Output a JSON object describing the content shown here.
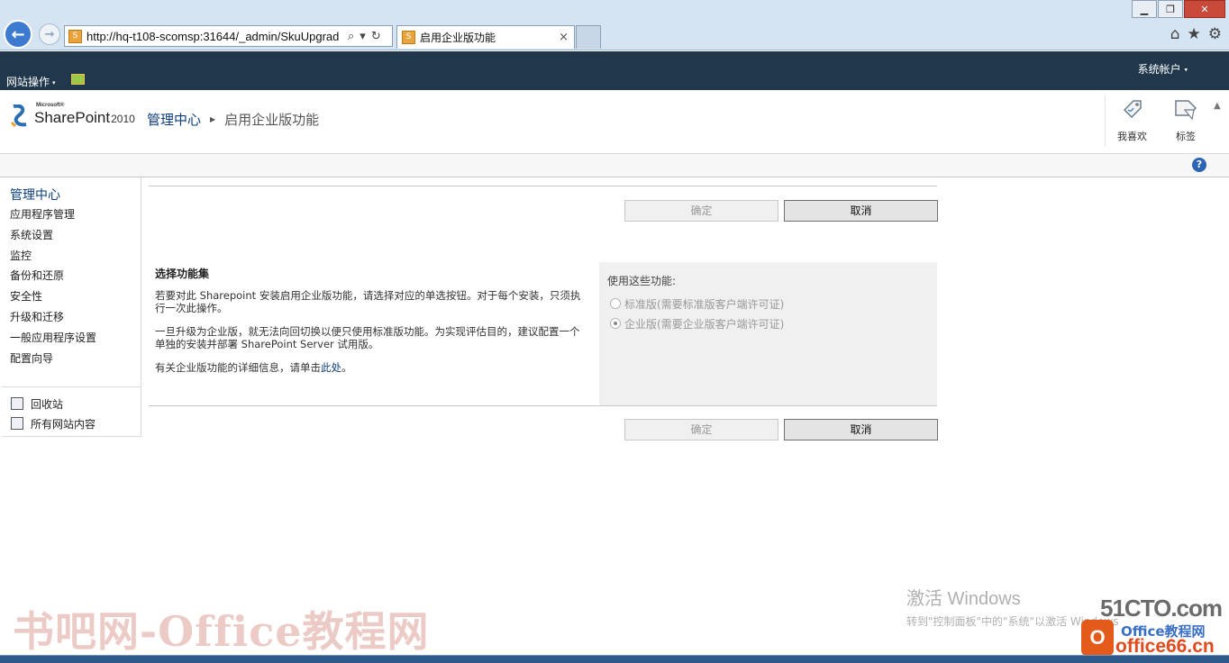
{
  "browser": {
    "address": "http://hq-t108-scomsp:31644/_admin/SkuUpgrad",
    "tab_title": "启用企业版功能",
    "tab_close": "×",
    "win_min": "▁",
    "win_restore": "❐",
    "win_close": "✕",
    "back_glyph": "←",
    "fwd_glyph": "→",
    "search_glyph": "⌕",
    "dropdown_glyph": "▾",
    "refresh_glyph": "↻",
    "home_glyph": "⌂",
    "fav_glyph": "★",
    "settings_glyph": "⚙"
  },
  "ribbon": {
    "site_actions": "网站操作",
    "caret": "▾",
    "account": "系统帐户",
    "account_caret": "▾"
  },
  "logo": {
    "microsoft": "Microsoft®",
    "product": "SharePoint",
    "year": "2010"
  },
  "breadcrumb": {
    "root": "管理中心",
    "sep": "▶",
    "current": "启用企业版功能"
  },
  "social": {
    "like": "我喜欢",
    "tags": "标签"
  },
  "help": "?",
  "left_nav": {
    "heading": "管理中心",
    "items": [
      "应用程序管理",
      "系统设置",
      "监控",
      "备份和还原",
      "安全性",
      "升级和迁移",
      "一般应用程序设置",
      "配置向导"
    ],
    "recycle_bin": "回收站",
    "all_content": "所有网站内容"
  },
  "form": {
    "ok_label": "确定",
    "cancel_label": "取消",
    "section_title": "选择功能集",
    "para1": "若要对此 Sharepoint 安装启用企业版功能，请选择对应的单选按钮。对于每个安装，只须执行一次此操作。",
    "para2": "一旦升级为企业版，就无法向回切换以便只使用标准版功能。为实现评估目的，建议配置一个单独的安装并部署 SharePoint Server 试用版。",
    "para3_prefix": "有关企业版功能的详细信息，请单击",
    "para3_link": "此处",
    "para3_suffix": "。",
    "options_label": "使用这些功能:",
    "option_standard": "标准版(需要标准版客户端许可证)",
    "option_enterprise": "企业版(需要企业版客户端许可证)"
  },
  "overlay": {
    "activate_title": "激活 Windows",
    "activate_sub": "转到\"控制面板\"中的\"系统\"以激活 Windows",
    "watermark": "书吧网-Office教程网",
    "logo_51cto": "51CTO.com",
    "office_tag": "Office教程网",
    "office_domain": "office66.cn",
    "office_mark": "O"
  },
  "colors": {
    "ribbon_bg": "#21374c",
    "link": "#0b3d7a",
    "options_bg": "#f0f0f0"
  }
}
